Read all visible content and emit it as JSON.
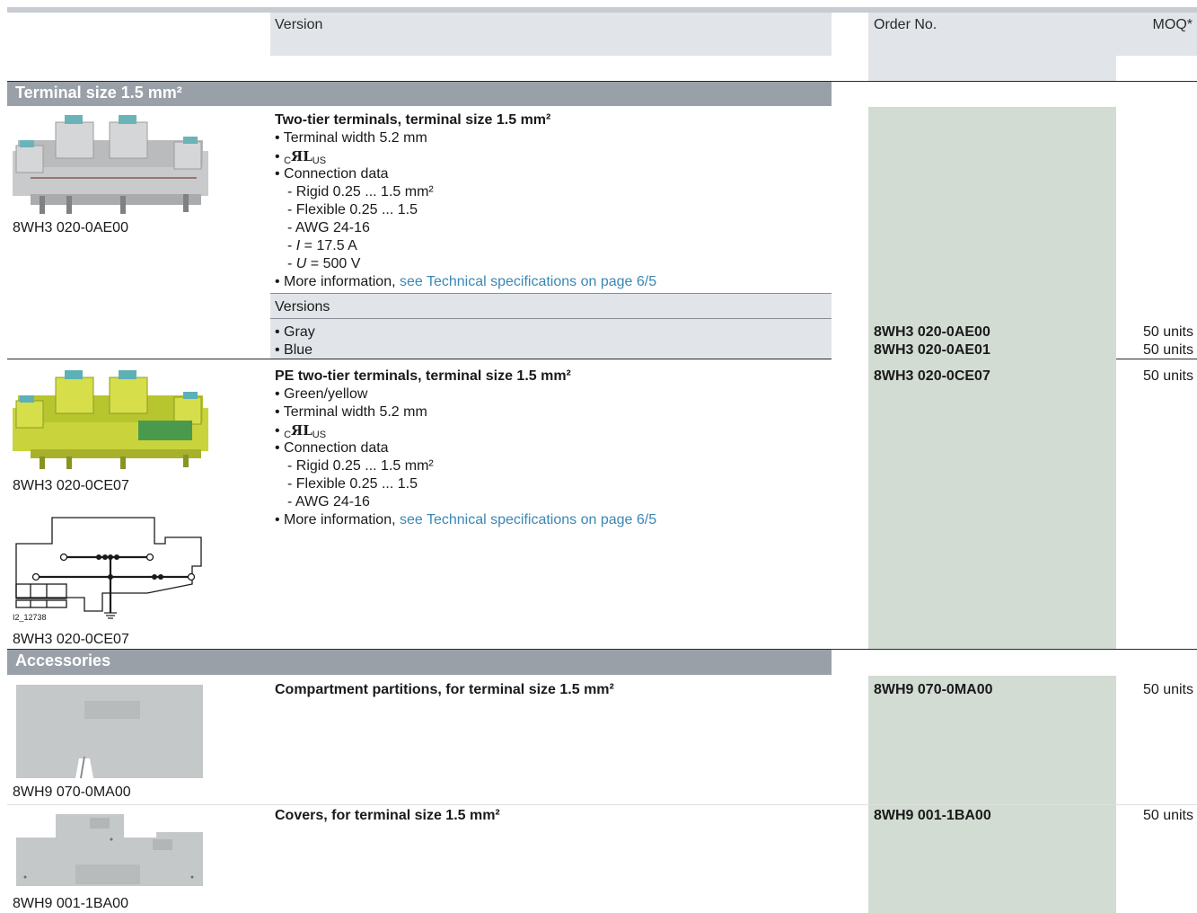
{
  "header": {
    "version": "Version",
    "order_no": "Order No.",
    "moq": "MOQ*"
  },
  "sections": {
    "terminal": "Terminal size 1.5 mm²",
    "accessories": "Accessories"
  },
  "item1": {
    "caption": "8WH3 020-0AE00",
    "title": "Two-tier terminals, terminal size 1.5 mm²",
    "lines": {
      "width": "• Terminal width 5.2 mm",
      "bullet": "•",
      "ul_c": "C",
      "ul_mark": "ЯL",
      "ul_us": "US",
      "conn": "• Connection data",
      "rigid": "- Rigid 0.25 ... 1.5 mm²",
      "flex": "- Flexible 0.25 ... 1.5",
      "awg": "- AWG 24-16",
      "i_pre": "- ",
      "i_sym": "I",
      "i_val": " = 17.5 A",
      "u_pre": "- ",
      "u_sym": "U",
      "u_val": " = 500 V",
      "more_pre": "• More information, ",
      "more_link": "see Technical specifications on page 6/5"
    },
    "versions_label": "Versions",
    "versions": [
      {
        "name": "• Gray",
        "order": "8WH3 020-0AE00",
        "moq": "50 units"
      },
      {
        "name": "• Blue",
        "order": "8WH3 020-0AE01",
        "moq": "50 units"
      }
    ]
  },
  "item2": {
    "caption": "8WH3 020-0CE07",
    "caption2": "8WH3 020-0CE07",
    "diagram_id": "I2_12738",
    "title": "PE two-tier terminals, terminal size 1.5 mm²",
    "order": "8WH3 020-0CE07",
    "moq": "50 units",
    "lines": {
      "color": "• Green/yellow",
      "width": "• Terminal width 5.2 mm",
      "bullet": "•",
      "ul_c": "C",
      "ul_mark": "ЯL",
      "ul_us": "US",
      "conn": "• Connection data",
      "rigid": "- Rigid 0.25 ... 1.5 mm²",
      "flex": "- Flexible 0.25 ... 1.5",
      "awg": "- AWG 24-16",
      "more_pre": "• More information, ",
      "more_link": "see Technical specifications on page 6/5"
    }
  },
  "item3": {
    "caption": "8WH9 070-0MA00",
    "title": "Compartment partitions, for terminal size 1.5 mm²",
    "order": "8WH9 070-0MA00",
    "moq": "50 units"
  },
  "item4": {
    "caption": "8WH9 001-1BA00",
    "title": "Covers, for terminal size 1.5 mm²",
    "order": "8WH9 001-1BA00",
    "moq": "50 units"
  }
}
